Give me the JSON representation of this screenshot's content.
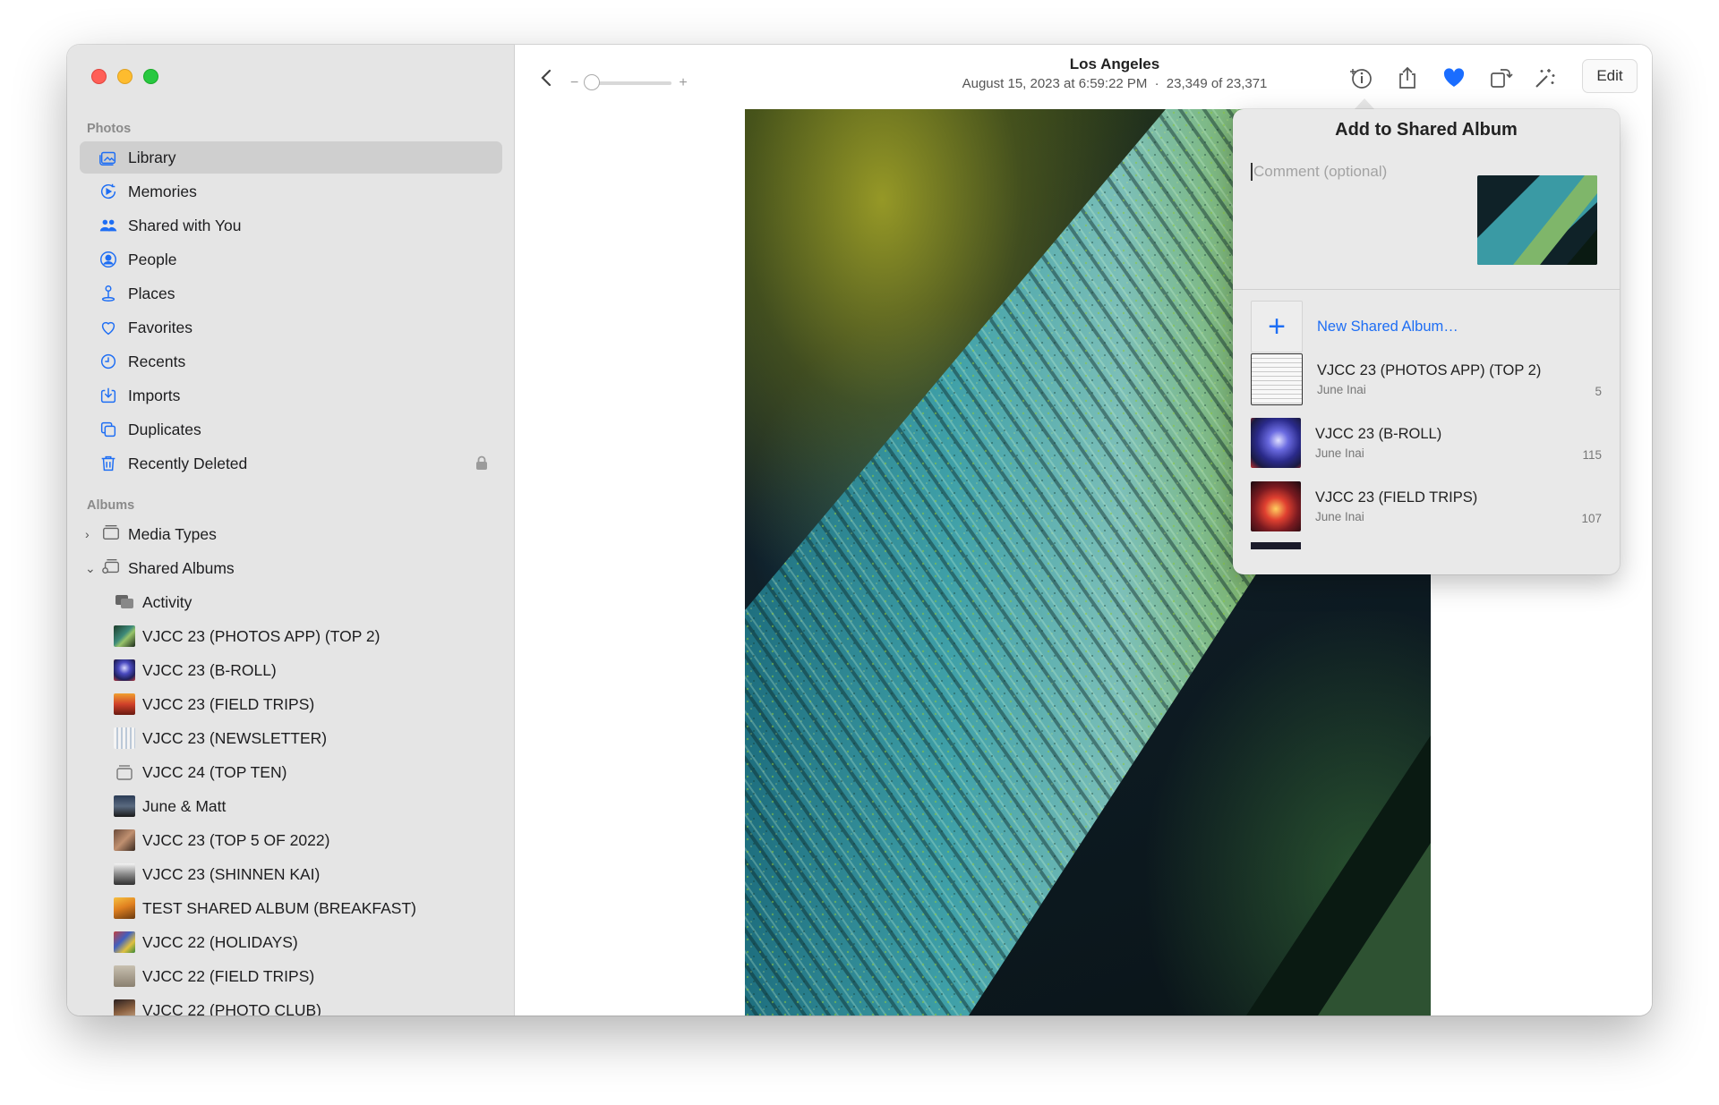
{
  "sidebar": {
    "photos_header": "Photos",
    "items": [
      {
        "label": "Library",
        "icon": "library-icon"
      },
      {
        "label": "Memories",
        "icon": "memories-icon"
      },
      {
        "label": "Shared with You",
        "icon": "shared-with-you-icon"
      },
      {
        "label": "People",
        "icon": "people-icon"
      },
      {
        "label": "Places",
        "icon": "places-icon"
      },
      {
        "label": "Favorites",
        "icon": "heart-icon"
      },
      {
        "label": "Recents",
        "icon": "clock-icon"
      },
      {
        "label": "Imports",
        "icon": "import-icon"
      },
      {
        "label": "Duplicates",
        "icon": "duplicates-icon"
      },
      {
        "label": "Recently Deleted",
        "icon": "trash-icon"
      }
    ],
    "albums_header": "Albums",
    "media_types": "Media Types",
    "shared_albums": "Shared Albums",
    "shared_album_items": [
      "Activity",
      "VJCC 23 (PHOTOS APP) (TOP 2)",
      "VJCC 23 (B-ROLL)",
      "VJCC 23 (FIELD TRIPS)",
      "VJCC 23 (NEWSLETTER)",
      "VJCC 24 (TOP TEN)",
      "June & Matt",
      "VJCC 23 (TOP 5 OF 2022)",
      "VJCC 23 (SHINNEN KAI)",
      "TEST SHARED ALBUM (BREAKFAST)",
      "VJCC 22 (HOLIDAYS)",
      "VJCC 22 (FIELD TRIPS)",
      "VJCC 22 (PHOTO CLUB)"
    ]
  },
  "toolbar": {
    "location": "Los Angeles",
    "datetime": "August 15, 2023 at 6:59:22 PM",
    "separator": "·",
    "position": "23,349 of 23,371",
    "zoom_minus": "−",
    "zoom_plus": "+",
    "edit_label": "Edit"
  },
  "popover": {
    "title": "Add to Shared Album",
    "comment_placeholder": "Comment (optional)",
    "new_album": "New Shared Album…",
    "albums": [
      {
        "name": "VJCC 23 (PHOTOS APP) (TOP 2)",
        "owner": "June Inai",
        "count": "5"
      },
      {
        "name": "VJCC 23 (B-ROLL)",
        "owner": "June Inai",
        "count": "115"
      },
      {
        "name": "VJCC 23 (FIELD TRIPS)",
        "owner": "June Inai",
        "count": "107"
      }
    ]
  },
  "colors": {
    "accent": "#1e6ef4",
    "favorite": "#1a6dff",
    "sidebar_bg": "#e5e5e5"
  }
}
